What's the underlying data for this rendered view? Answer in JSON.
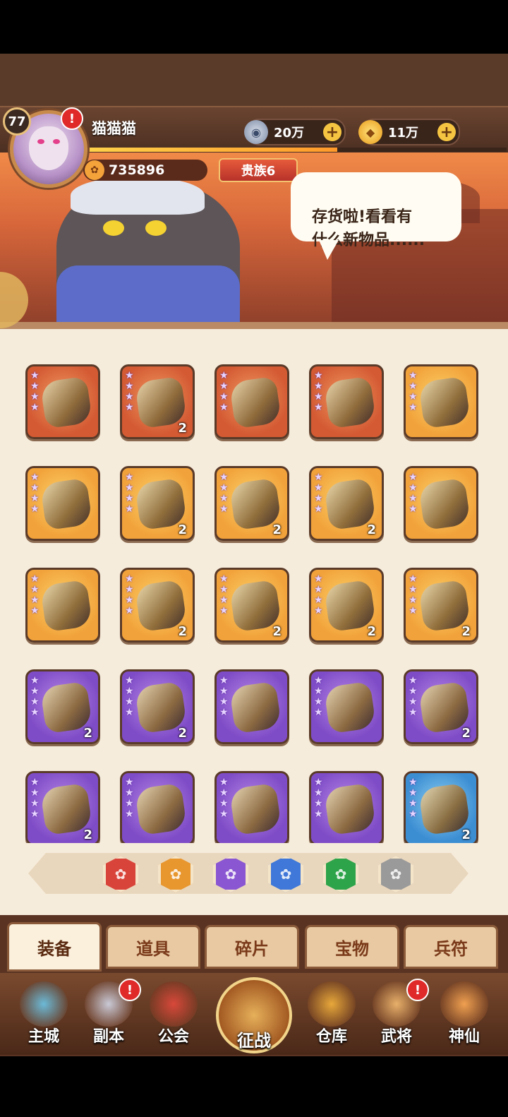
{
  "player": {
    "level": "77",
    "name": "猫猫猫",
    "power": "735896",
    "vip": "贵族6",
    "xp_fraction": 0.6
  },
  "currencies": [
    {
      "icon": "coin-icon",
      "value": "20万"
    },
    {
      "icon": "gold-ingot-icon",
      "value": "11万"
    }
  ],
  "banner": {
    "speech": "存货啦!看看有\n什么新物品......"
  },
  "alert_mark": "!",
  "items": [
    {
      "rarity": "red",
      "stars": 4,
      "count": ""
    },
    {
      "rarity": "red",
      "stars": 4,
      "count": "2"
    },
    {
      "rarity": "red",
      "stars": 4,
      "count": ""
    },
    {
      "rarity": "red",
      "stars": 4,
      "count": ""
    },
    {
      "rarity": "orange",
      "stars": 4,
      "count": ""
    },
    {
      "rarity": "orange",
      "stars": 4,
      "count": ""
    },
    {
      "rarity": "orange",
      "stars": 4,
      "count": "2"
    },
    {
      "rarity": "orange",
      "stars": 4,
      "count": "2"
    },
    {
      "rarity": "orange",
      "stars": 4,
      "count": "2"
    },
    {
      "rarity": "orange",
      "stars": 4,
      "count": ""
    },
    {
      "rarity": "orange",
      "stars": 4,
      "count": ""
    },
    {
      "rarity": "orange",
      "stars": 4,
      "count": "2"
    },
    {
      "rarity": "orange",
      "stars": 4,
      "count": "2"
    },
    {
      "rarity": "orange",
      "stars": 4,
      "count": "2"
    },
    {
      "rarity": "orange",
      "stars": 4,
      "count": "2"
    },
    {
      "rarity": "purple",
      "stars": 4,
      "count": "2"
    },
    {
      "rarity": "purple",
      "stars": 4,
      "count": "2"
    },
    {
      "rarity": "purple",
      "stars": 4,
      "count": ""
    },
    {
      "rarity": "purple",
      "stars": 4,
      "count": ""
    },
    {
      "rarity": "purple",
      "stars": 4,
      "count": "2"
    },
    {
      "rarity": "purple",
      "stars": 4,
      "count": "2"
    },
    {
      "rarity": "purple",
      "stars": 4,
      "count": ""
    },
    {
      "rarity": "purple",
      "stars": 4,
      "count": ""
    },
    {
      "rarity": "purple",
      "stars": 4,
      "count": ""
    },
    {
      "rarity": "blue",
      "stars": 4,
      "count": "2"
    }
  ],
  "rarity_filters": [
    {
      "name": "filter-red",
      "color": "#d9443a"
    },
    {
      "name": "filter-orange",
      "color": "#e8962e"
    },
    {
      "name": "filter-purple",
      "color": "#8a56d2"
    },
    {
      "name": "filter-blue",
      "color": "#3f78d8"
    },
    {
      "name": "filter-green",
      "color": "#2ea44a"
    },
    {
      "name": "filter-gray",
      "color": "#9a9a9a"
    }
  ],
  "tabs": [
    {
      "label": "装备",
      "active": true
    },
    {
      "label": "道具",
      "active": false
    },
    {
      "label": "碎片",
      "active": false
    },
    {
      "label": "宝物",
      "active": false
    },
    {
      "label": "兵符",
      "active": false
    }
  ],
  "nav": [
    {
      "label": "主城",
      "icon": "castle-icon",
      "alert": false
    },
    {
      "label": "副本",
      "icon": "sword-icon",
      "alert": true
    },
    {
      "label": "公会",
      "icon": "flag-icon",
      "alert": false
    },
    {
      "label": "征战",
      "icon": "battle-icon",
      "alert": false
    },
    {
      "label": "仓库",
      "icon": "treasure-bag-icon",
      "alert": false
    },
    {
      "label": "武将",
      "icon": "general-cat-icon",
      "alert": true
    },
    {
      "label": "神仙",
      "icon": "cat-face-icon",
      "alert": false
    }
  ]
}
